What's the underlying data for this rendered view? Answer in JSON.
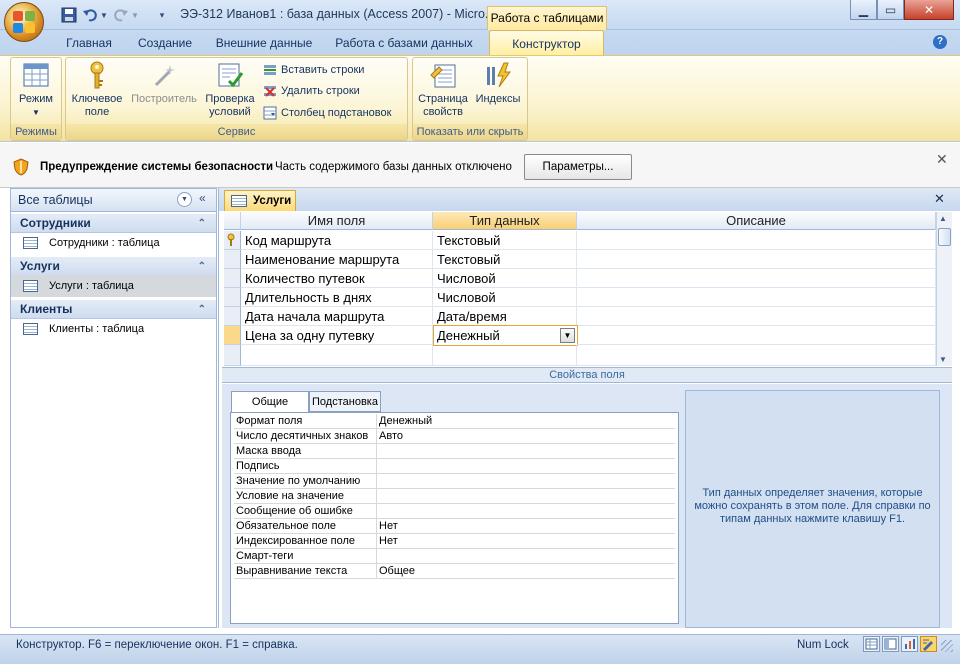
{
  "window": {
    "title": "ЭЭ-312 Иванов1 : база данных (Access 2007) - Micro...",
    "context_tab_title": "Работа с таблицами",
    "min_icon": "minimize-icon",
    "max_icon": "maximize-icon",
    "close_icon": "close-icon"
  },
  "tabs": [
    "Главная",
    "Создание",
    "Внешние данные",
    "Работа с базами данных",
    "Конструктор"
  ],
  "ribbon": {
    "groups": {
      "modes": "Режимы",
      "service": "Сервис",
      "show_hide": "Показать или скрыть"
    },
    "buttons": {
      "mode": "Режим",
      "primary_key_1": "Ключевое",
      "primary_key_2": "поле",
      "builder": "Построитель",
      "check_1": "Проверка",
      "check_2": "условий",
      "insert_rows": "Вставить строки",
      "delete_rows": "Удалить строки",
      "lookup_column": "Столбец  подстановок",
      "prop_sheet_1": "Страница",
      "prop_sheet_2": "свойств",
      "indexes": "Индексы"
    }
  },
  "security": {
    "title": "Предупреждение системы безопасности",
    "message": "Часть содержимого базы данных отключено",
    "button": "Параметры..."
  },
  "nav": {
    "header": "Все таблицы",
    "groups": [
      {
        "name": "Сотрудники",
        "item": "Сотрудники : таблица"
      },
      {
        "name": "Услуги",
        "item": "Услуги : таблица"
      },
      {
        "name": "Клиенты",
        "item": "Клиенты : таблица"
      }
    ]
  },
  "document": {
    "tab": "Услуги",
    "columns": [
      "Имя поля",
      "Тип данных",
      "Описание"
    ],
    "rows": [
      {
        "name": "Код маршрута",
        "type": "Текстовый",
        "desc": ""
      },
      {
        "name": "Наименование маршрута",
        "type": "Текстовый",
        "desc": ""
      },
      {
        "name": "Количество путевок",
        "type": "Числовой",
        "desc": ""
      },
      {
        "name": "Длительность в днях",
        "type": "Числовой",
        "desc": ""
      },
      {
        "name": "Дата начала маршрута",
        "type": "Дата/время",
        "desc": ""
      },
      {
        "name": "Цена за одну путевку",
        "type": "Денежный",
        "desc": ""
      }
    ]
  },
  "properties": {
    "bar_label": "Свойства поля",
    "tabs": [
      "Общие",
      "Подстановка"
    ],
    "rows": [
      {
        "label": "Формат поля",
        "value": "Денежный"
      },
      {
        "label": "Число десятичных знаков",
        "value": "Авто"
      },
      {
        "label": "Маска ввода",
        "value": ""
      },
      {
        "label": "Подпись",
        "value": ""
      },
      {
        "label": "Значение по умолчанию",
        "value": ""
      },
      {
        "label": "Условие на значение",
        "value": ""
      },
      {
        "label": "Сообщение об ошибке",
        "value": ""
      },
      {
        "label": "Обязательное поле",
        "value": "Нет"
      },
      {
        "label": "Индексированное поле",
        "value": "Нет"
      },
      {
        "label": "Смарт-теги",
        "value": ""
      },
      {
        "label": "Выравнивание текста",
        "value": "Общее"
      }
    ],
    "help": "Тип данных определяет значения, которые можно сохранять в этом поле.  Для справки по типам данных нажмите клавишу F1."
  },
  "status": {
    "text": "Конструктор.  F6 = переключение окон.  F1 = справка.",
    "numlock": "Num Lock"
  }
}
